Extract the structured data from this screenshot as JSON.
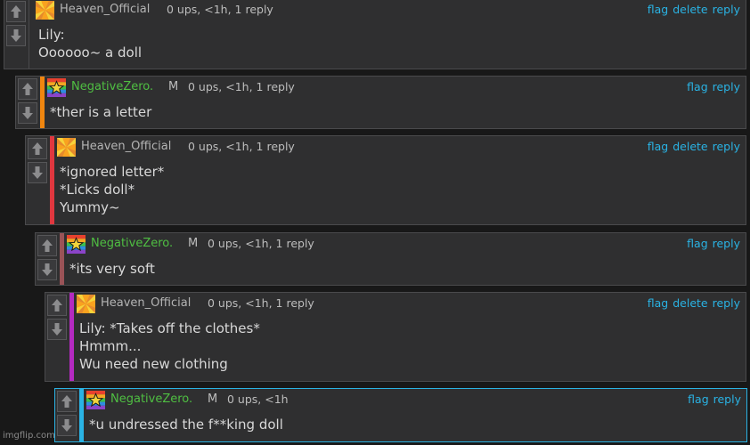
{
  "comments": [
    {
      "username": "Heaven_Official",
      "mod": "",
      "meta": "0 ups, <1h, 1 reply",
      "actions": [
        "flag",
        "delete",
        "reply"
      ],
      "text": "Lily:\nOooooo~ a doll",
      "bar_color": ""
    },
    {
      "username": "NegativeZero.",
      "mod": "M",
      "meta": "0 ups, <1h, 1 reply",
      "actions": [
        "flag",
        "reply"
      ],
      "text": "*ther is a letter",
      "bar_color": "#f0860f"
    },
    {
      "username": "Heaven_Official",
      "mod": "",
      "meta": "0 ups, <1h, 1 reply",
      "actions": [
        "flag",
        "delete",
        "reply"
      ],
      "text": "*ignored letter*\n*Licks doll*\nYummy~",
      "bar_color": "#e0373f"
    },
    {
      "username": "NegativeZero.",
      "mod": "M",
      "meta": "0 ups, <1h, 1 reply",
      "actions": [
        "flag",
        "reply"
      ],
      "text": "*its very soft",
      "bar_color": "#9a5357"
    },
    {
      "username": "Heaven_Official",
      "mod": "",
      "meta": "0 ups, <1h, 1 reply",
      "actions": [
        "flag",
        "delete",
        "reply"
      ],
      "text": "Lily: *Takes off the clothes*\nHmmm...\nWu need new clothing",
      "bar_color": "#b42ac1"
    },
    {
      "username": "NegativeZero.",
      "mod": "M",
      "meta": "0 ups, <1h",
      "actions": [
        "flag",
        "reply"
      ],
      "text": "*u undressed the f**king doll",
      "bar_color": "#2ab3e4"
    }
  ],
  "watermark": "imgflip.com",
  "colors": {
    "link": "#2ab3e4",
    "negative_name": "#4fbf42",
    "heaven_name": "#b4b4b4",
    "active_border": "#2ab3e4"
  }
}
